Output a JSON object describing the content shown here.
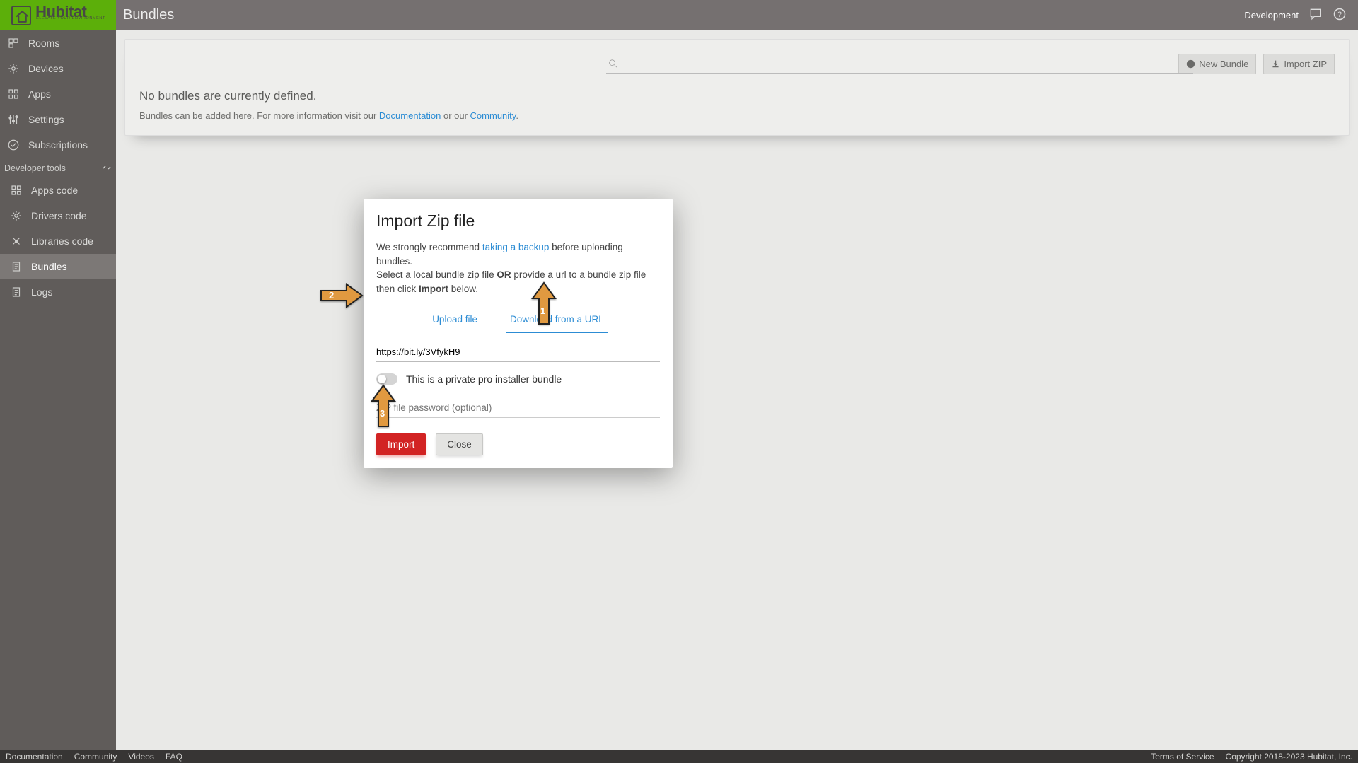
{
  "header": {
    "page_title": "Bundles",
    "mode": "Development"
  },
  "brand": {
    "name": "Hubitat",
    "tagline": "ELEVATE YOUR ENVIRONMENT"
  },
  "sidebar": {
    "items": [
      {
        "label": "Rooms"
      },
      {
        "label": "Devices"
      },
      {
        "label": "Apps"
      },
      {
        "label": "Settings"
      },
      {
        "label": "Subscriptions"
      }
    ],
    "dev_section_title": "Developer tools",
    "dev_items": [
      {
        "label": "Apps code"
      },
      {
        "label": "Drivers code"
      },
      {
        "label": "Libraries code"
      },
      {
        "label": "Bundles"
      },
      {
        "label": "Logs"
      }
    ]
  },
  "toolbar": {
    "new_bundle": "New Bundle",
    "import_zip": "Import ZIP"
  },
  "empty": {
    "title": "No bundles are currently defined.",
    "text_pre": "Bundles can be added here. For more information visit our ",
    "doc_link": "Documentation",
    "text_mid": " or our ",
    "community_link": "Community",
    "text_post": "."
  },
  "modal": {
    "title": "Import Zip file",
    "rec_pre": "We strongly recommend ",
    "rec_link": "taking a backup",
    "rec_post": " before uploading bundles.",
    "select_pre": "Select a local bundle zip file ",
    "select_or": "OR",
    "select_mid": " provide a url to a bundle zip file then click ",
    "select_strong": "Import",
    "select_post": " below.",
    "tab_upload": "Upload file",
    "tab_url": "Download from a URL",
    "url_value": "https://bit.ly/3VfykH9",
    "toggle_label": "This is a private pro installer bundle",
    "pw_placeholder": "ZIP file password (optional)",
    "btn_import": "Import",
    "btn_close": "Close"
  },
  "arrows": {
    "n1": "1",
    "n2": "2",
    "n3": "3"
  },
  "footer": {
    "links": [
      "Documentation",
      "Community",
      "Videos",
      "FAQ"
    ],
    "tos": "Terms of Service",
    "copyright": "Copyright 2018-2023 Hubitat, Inc."
  }
}
